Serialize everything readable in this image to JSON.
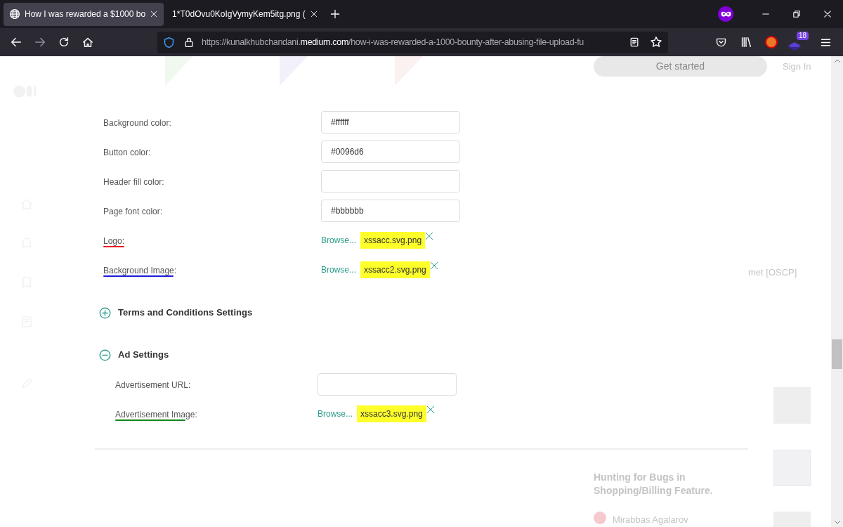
{
  "browser": {
    "tabs": [
      {
        "title": "How I was rewarded a $1000 bo",
        "selected": true
      },
      {
        "title": "1*T0dOvu0KoIgVymyKem5itg.png (",
        "selected": false
      }
    ],
    "url": {
      "prefix": "https://kunalkhubchandani.",
      "domain": "medium.com",
      "path": "/how-i-was-rewarded-a-1000-bounty-after-abusing-file-upload-fu"
    },
    "extension_badge": "18"
  },
  "page_behind": {
    "get_started": "Get started",
    "sign_in": "Sign In",
    "side_text": "met [OSCP]",
    "related_title": "Hunting for Bugs in Shopping/Billing Feature.",
    "related_author": "Mirabbas Agalarov"
  },
  "form": {
    "fields": [
      {
        "kind": "text",
        "label": "Background color:",
        "value": "#ffffff"
      },
      {
        "kind": "text",
        "label": "Button color:",
        "value": "#0096d6"
      },
      {
        "kind": "text",
        "label": "Header fill color:"
      },
      {
        "kind": "text",
        "label": "Page font color:",
        "value": "#bbbbbb"
      },
      {
        "kind": "file",
        "label": "Logo:",
        "browse": "Browse...",
        "file": "xssacc.svg.png",
        "color": "#e8141b"
      },
      {
        "kind": "file",
        "label": "Background Image:",
        "browse": "Browse...",
        "file": "xssacc2.svg.png",
        "color": "#1b1bd8"
      }
    ],
    "sections": [
      {
        "title": "Terms and Conditions Settings",
        "expanded": false
      },
      {
        "title": "Ad Settings",
        "expanded": true,
        "fields": [
          {
            "kind": "text",
            "label": "Advertisement URL:"
          },
          {
            "kind": "file",
            "label": "Advertisement Image:",
            "browse": "Browse...",
            "file": "xssacc3.svg.png",
            "color": "#12861a"
          }
        ]
      }
    ]
  }
}
